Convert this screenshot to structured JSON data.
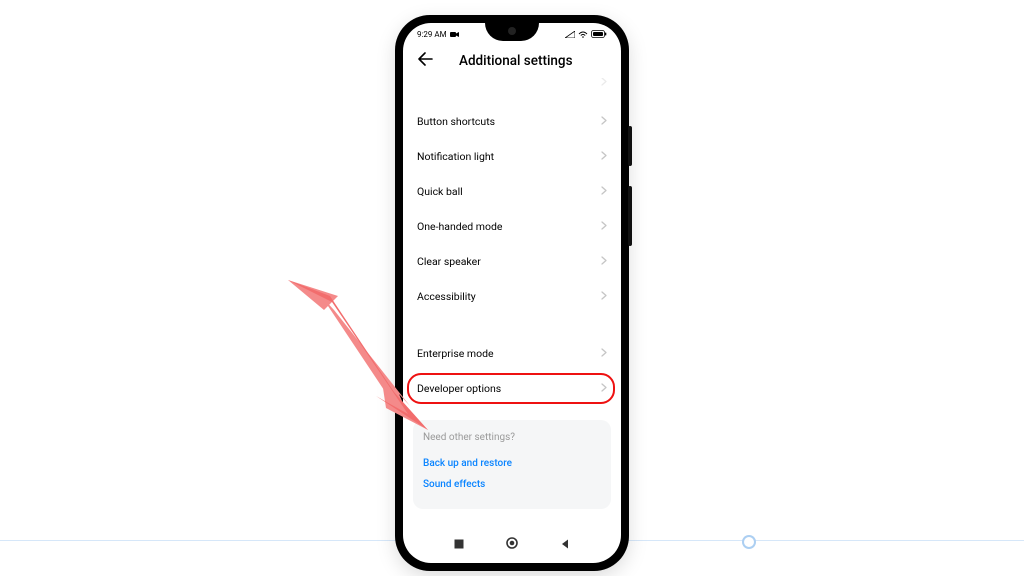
{
  "statusbar": {
    "time": "9:29 AM"
  },
  "header": {
    "title": "Additional settings"
  },
  "rows": {
    "cutoff": "",
    "r0": "Button shortcuts",
    "r1": "Notification light",
    "r2": "Quick ball",
    "r3": "One-handed mode",
    "r4": "Clear speaker",
    "r5": "Accessibility",
    "r6": "Enterprise mode",
    "r7": "Developer options"
  },
  "card": {
    "question": "Need other settings?",
    "link0": "Back up and restore",
    "link1": "Sound effects"
  }
}
